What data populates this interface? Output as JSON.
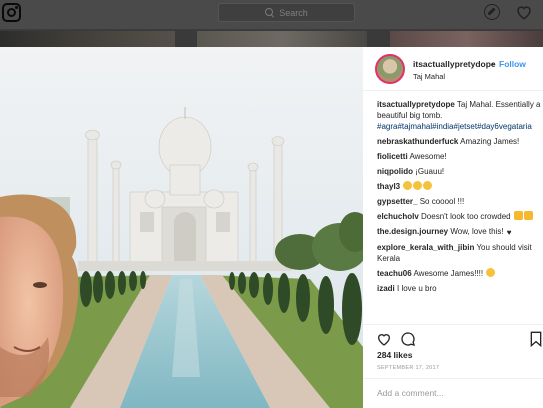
{
  "nav": {
    "logo_icon": "instagram-camera-icon",
    "search_placeholder": "Search",
    "explore_icon": "compass-icon",
    "activity_icon": "heart-icon"
  },
  "post": {
    "username": "itsactuallypretydope",
    "follow_separator": "•",
    "follow_label": "Follow",
    "location": "Taj Mahal",
    "caption_user": "itsactuallypretydope",
    "caption_text": " Taj Mahal. Essentially a beautiful big tomb.",
    "caption_tags": "#agra#tajmahal#india#jetset#day6vegataria",
    "likes": "284 likes",
    "date": "SEPTEMBER 17, 2017",
    "add_comment_placeholder": "Add a comment...",
    "comments": [
      {
        "user": "nebraskathunderfuck",
        "text": " Amazing James!"
      },
      {
        "user": "fiolicetti",
        "text": " Awesome!"
      },
      {
        "user": "niqpolido",
        "text": " ¡Guauu!"
      },
      {
        "user": "thayl3",
        "text": " "
      },
      {
        "user": "gypsetter_",
        "text": " So cooool !!!"
      },
      {
        "user": "elchucholv",
        "text": " Doesn't look too crowded "
      },
      {
        "user": "the.design.journey",
        "text": " Wow, love this! "
      },
      {
        "user": "explore_kerala_with_jibin",
        "text": " You should visit Kerala"
      },
      {
        "user": "teachu06",
        "text": " Awesome James!!!! "
      },
      {
        "user": "izadi",
        "text": " I love u bro"
      }
    ]
  },
  "colors": {
    "link_blue": "#3897f0",
    "hashtag_blue": "#003569",
    "topbar": "#4a4a4a"
  }
}
